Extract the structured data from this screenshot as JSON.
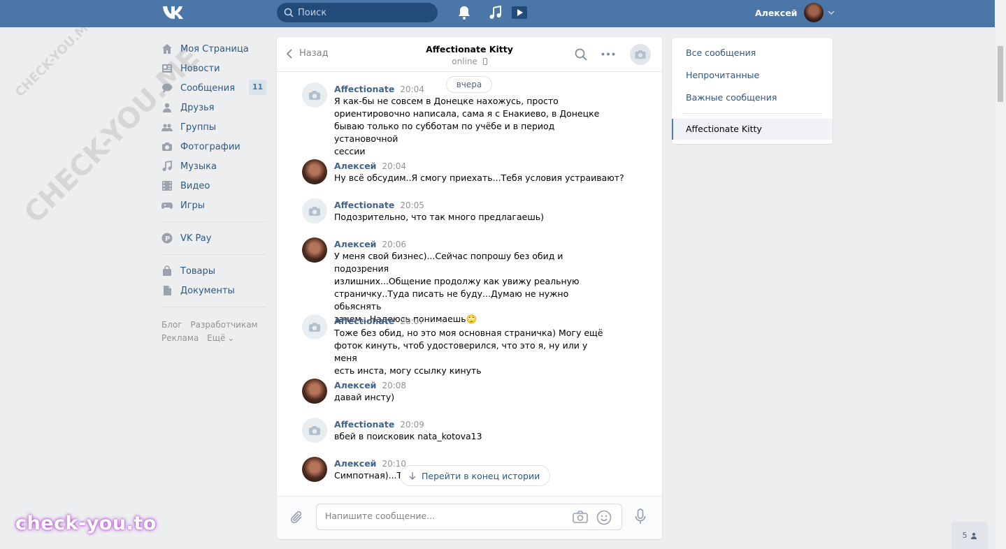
{
  "header": {
    "search_placeholder": "Поиск",
    "user_name": "Алексей"
  },
  "leftnav": {
    "items": [
      {
        "label": "Моя Страница",
        "icon": "home-icon"
      },
      {
        "label": "Новости",
        "icon": "news-icon"
      },
      {
        "label": "Сообщения",
        "icon": "messages-icon",
        "badge": "11"
      },
      {
        "label": "Друзья",
        "icon": "friends-icon"
      },
      {
        "label": "Группы",
        "icon": "groups-icon"
      },
      {
        "label": "Фотографии",
        "icon": "photos-icon"
      },
      {
        "label": "Музыка",
        "icon": "music-icon"
      },
      {
        "label": "Видео",
        "icon": "video-icon"
      },
      {
        "label": "Игры",
        "icon": "games-icon"
      }
    ],
    "vkpay": "VK Pay",
    "goods": "Товары",
    "docs": "Документы",
    "footer": {
      "blog": "Блог",
      "dev": "Разработчикам",
      "ads": "Реклама",
      "more": "Ещё"
    }
  },
  "chat": {
    "back_label": "Назад",
    "title": "Affectionate Kitty",
    "status": "online",
    "date_divider": "вчера",
    "messages": [
      {
        "author": "Affectionate",
        "time": "20:04",
        "text": "Я как-бы не совсем в Донецке нахожусь, просто\nориентировочно написала, сама я с Енакиево, в Донецке\nбываю только по субботам по учёбе и в период установочной\nсессии"
      },
      {
        "author": "Алексей",
        "time": "20:04",
        "text": "Ну всё обсудим..Я смогу приехать...Тебя условия устраивают?"
      },
      {
        "author": "Affectionate",
        "time": "20:05",
        "text": "Подозрительно, что так много предлагаешь)"
      },
      {
        "author": "Алексей",
        "time": "20:06",
        "text": "У меня свой бизнес)...Сейчас попрошу без обид и подозрения\nизлишних...Общение продолжу как увижу реальную\nстраничку..Туда писать не буду...Думаю не нужно обьяснять\nзачем...Надеюсь понимаешь🙄"
      },
      {
        "author": "Affectionate",
        "time": "20:07",
        "text": "Тоже без обид, но это моя основная страничка) Могу ещё\nфоток кинуть, чтоб удостоверился, что это я, ну или у меня\nесть инста, могу ссылку кинуть"
      },
      {
        "author": "Алексей",
        "time": "20:08",
        "text": "давай инсту)"
      },
      {
        "author": "Affectionate",
        "time": "20:09",
        "text": "вбей в поисковик nata_kotova13"
      },
      {
        "author": "Алексей",
        "time": "20:10",
        "text": "Симпотная)...Те\n\nСколько лет?"
      }
    ],
    "jump_label": "Перейти в конец истории",
    "composer_placeholder": "Напишите сообщение..."
  },
  "rightpanel": {
    "all": "Все сообщения",
    "unread": "Непрочитанные",
    "important": "Важные сообщения",
    "active_chat": "Affectionate Kitty"
  },
  "watermark": {
    "text": "CHECK-YOU.ME",
    "brand": "check-you.to"
  },
  "online_counter": "5"
}
